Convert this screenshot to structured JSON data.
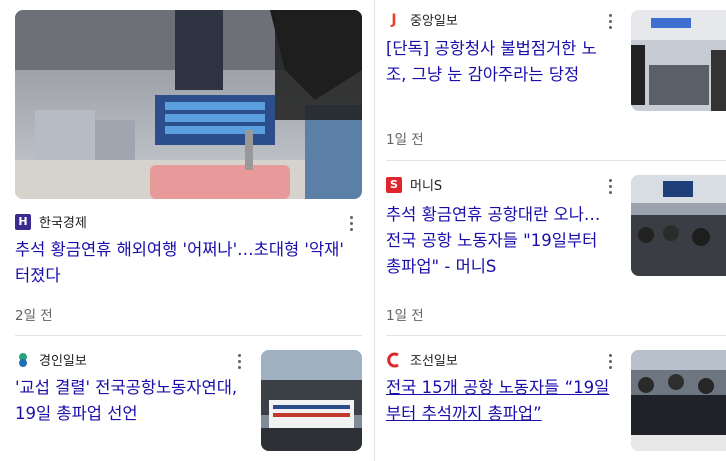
{
  "articles": [
    {
      "source": "한국경제",
      "logo_glyph": "H",
      "logo_color": "#3b2b8f",
      "headline": "추석 황금연휴 해외여행 '어쩌나'…초대형 '악재' 터졌다",
      "time": "2일 전"
    },
    {
      "source": "중앙일보",
      "logo_glyph": "J",
      "logo_color": "#e5432b",
      "headline": "[단독] 공항청사 불법점거한 노조, 그냥 눈 감아주라는 당정",
      "time": "1일 전"
    },
    {
      "source": "머니S",
      "logo_glyph": "S",
      "logo_color": "#e0252f",
      "headline": "추석 황금연휴 공항대란 오나… 전국 공항 노동자들 \"19일부터 총파업\" - 머니S",
      "time": "1일 전"
    },
    {
      "source": "경인일보",
      "logo_glyph": "",
      "logo_color": "#1f8a70",
      "headline": "'교섭 결렬' 전국공항노동자연대, 19일 총파업 선언",
      "time": ""
    },
    {
      "source": "조선일보",
      "logo_glyph": "",
      "logo_color": "#e0252f",
      "headline": "전국 15개 공항 노동자들 “19일부터 추석까지 총파업”",
      "time": ""
    }
  ]
}
